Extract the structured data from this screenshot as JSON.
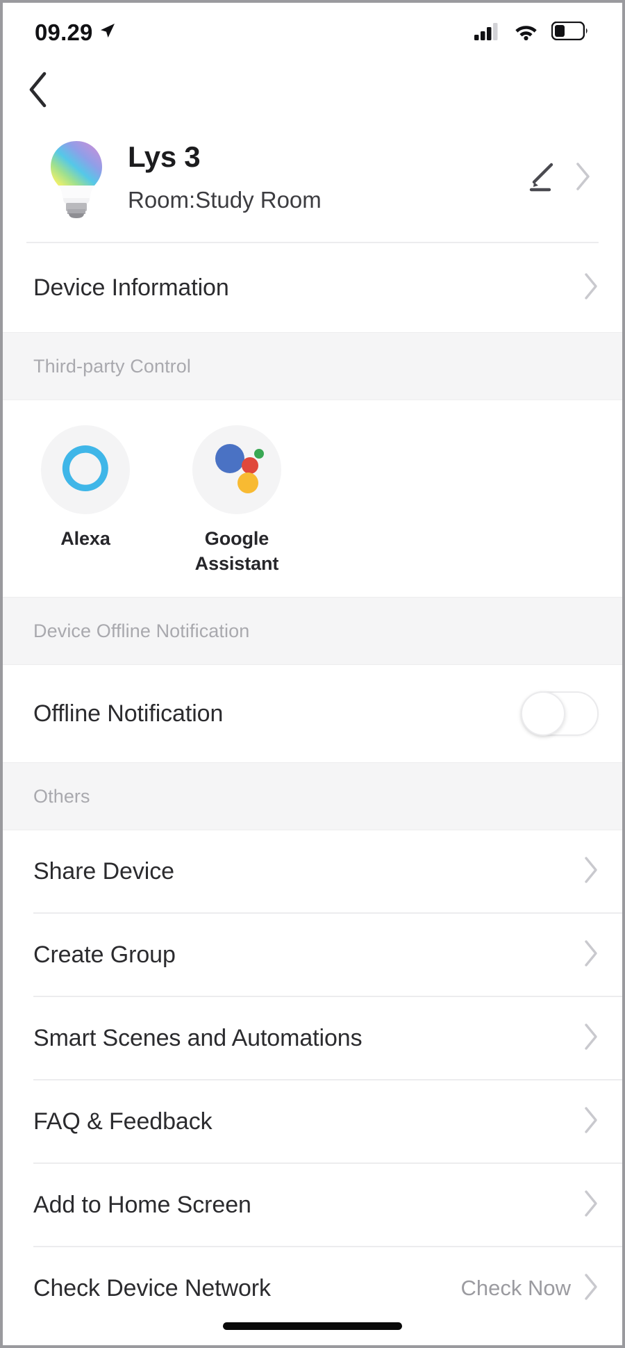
{
  "status_bar": {
    "time": "09.29",
    "location_icon": "location-arrow-icon",
    "cellular_icon": "cellular-signal-icon",
    "wifi_icon": "wifi-icon",
    "battery_icon": "battery-icon",
    "battery_level_percent": 32,
    "signal_bars_filled": 3,
    "signal_bars_total": 4
  },
  "nav": {
    "back_icon": "chevron-left-icon"
  },
  "device": {
    "icon": "light-bulb-icon",
    "name": "Lys 3",
    "room": "Room:Study Room",
    "edit_icon": "pencil-icon",
    "chevron_icon": "chevron-right-icon"
  },
  "device_information": {
    "label": "Device Information",
    "chevron_icon": "chevron-right-icon"
  },
  "third_party_control": {
    "section_title": "Third-party Control",
    "items": [
      {
        "label": "Alexa",
        "icon": "alexa-icon"
      },
      {
        "label": "Google Assistant",
        "icon": "google-assistant-icon"
      }
    ]
  },
  "offline_notification": {
    "section_title": "Device Offline Notification",
    "label": "Offline Notification",
    "toggle_state": "off"
  },
  "others": {
    "section_title": "Others",
    "items": [
      {
        "label": "Share Device",
        "value": "",
        "chevron_icon": "chevron-right-icon"
      },
      {
        "label": "Create Group",
        "value": "",
        "chevron_icon": "chevron-right-icon"
      },
      {
        "label": "Smart Scenes and Automations",
        "value": "",
        "chevron_icon": "chevron-right-icon"
      },
      {
        "label": "FAQ & Feedback",
        "value": "",
        "chevron_icon": "chevron-right-icon"
      },
      {
        "label": "Add to Home Screen",
        "value": "",
        "chevron_icon": "chevron-right-icon"
      },
      {
        "label": "Check Device Network",
        "value": "Check Now",
        "chevron_icon": "chevron-right-icon"
      }
    ]
  },
  "colors": {
    "section_background": "#f5f5f6",
    "section_title_text": "#a9a9ae",
    "row_text": "#2b2b2e",
    "value_text": "#9b9ba0",
    "chevron": "#c9c9ce",
    "alexa_blue": "#3fb6e8",
    "google_blue": "#4a72c4",
    "google_red": "#e0483c",
    "google_yellow": "#f8ba32",
    "google_green": "#39a854"
  },
  "home_indicator": "home-indicator-bar"
}
